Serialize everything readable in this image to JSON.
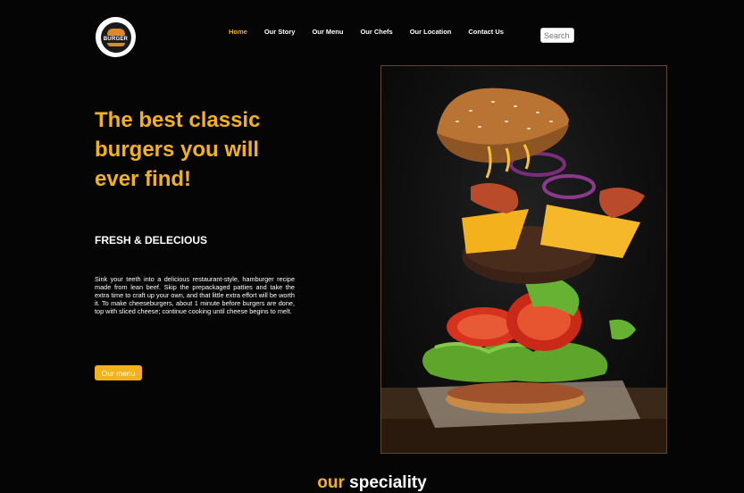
{
  "logo": {
    "text": "BURGER"
  },
  "nav": {
    "items": [
      {
        "label": "Home"
      },
      {
        "label": "Our Story"
      },
      {
        "label": "Our Menu"
      },
      {
        "label": "Our Chefs"
      },
      {
        "label": "Our Location"
      },
      {
        "label": "Contact Us"
      }
    ],
    "active": "Home"
  },
  "search": {
    "placeholder": "Search"
  },
  "hero": {
    "title": "The best classic burgers you will ever find!",
    "subtitle": "FRESH & DELECIOUS",
    "body": "Sink your teeth into a delicious restaurant-style, hamburger recipe made from lean beef. Skip the prepackaged patties and take the extra time to craft up your own, and that little extra effort will be worth it. To make cheeseburgers, about 1 minute before burgers are done, top with sliced cheese; continue cooking until cheese begins to melt.",
    "button_label": "Our menu"
  },
  "section": {
    "word1": "our",
    "word2": "speciality"
  },
  "colors": {
    "accent": "#f3b21d",
    "background": "#050505"
  }
}
